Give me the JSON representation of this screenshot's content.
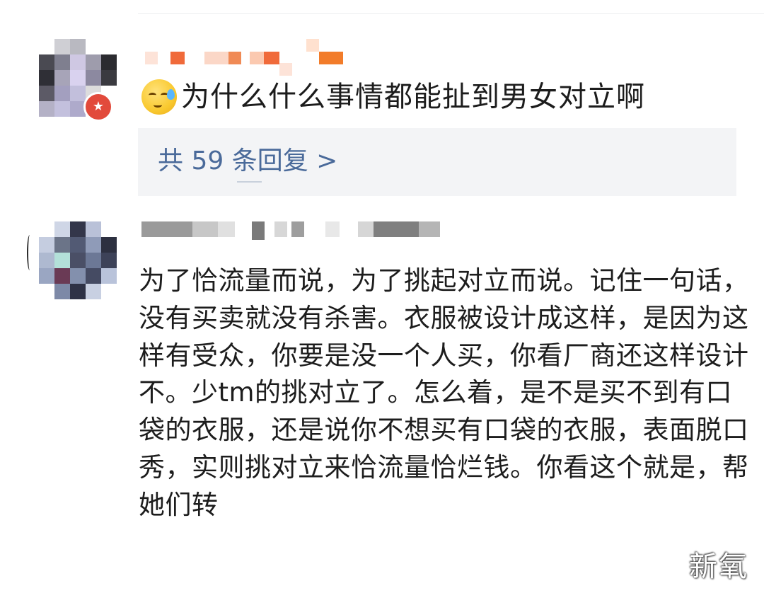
{
  "comments": [
    {
      "text": "为什么什么事情都能扯到男女对立啊",
      "emoji_icon": "sleepy-sweat-emoji",
      "badge_icon": "star-badge-icon",
      "replies_link": "共 59 条回复 >"
    },
    {
      "text": "为了恰流量而说，为了挑起对立而说。记住一句话，没有买卖就没有杀害。衣服被设计成这样，是因为这样有受众，你要是没一个人买，你看厂商还这样设计不。少tm的挑对立了。怎么着，是不是买不到有口袋的衣服，还是说你不想买有口袋的衣服，表面脱口秀，实则挑对立来恰流量恰烂钱。你看这个就是，帮她们转"
    }
  ],
  "watermark": "新氧",
  "colors": {
    "reply_link": "#4a6a9a",
    "reply_box_bg": "#f3f4f6",
    "badge": "#e24a3b"
  }
}
